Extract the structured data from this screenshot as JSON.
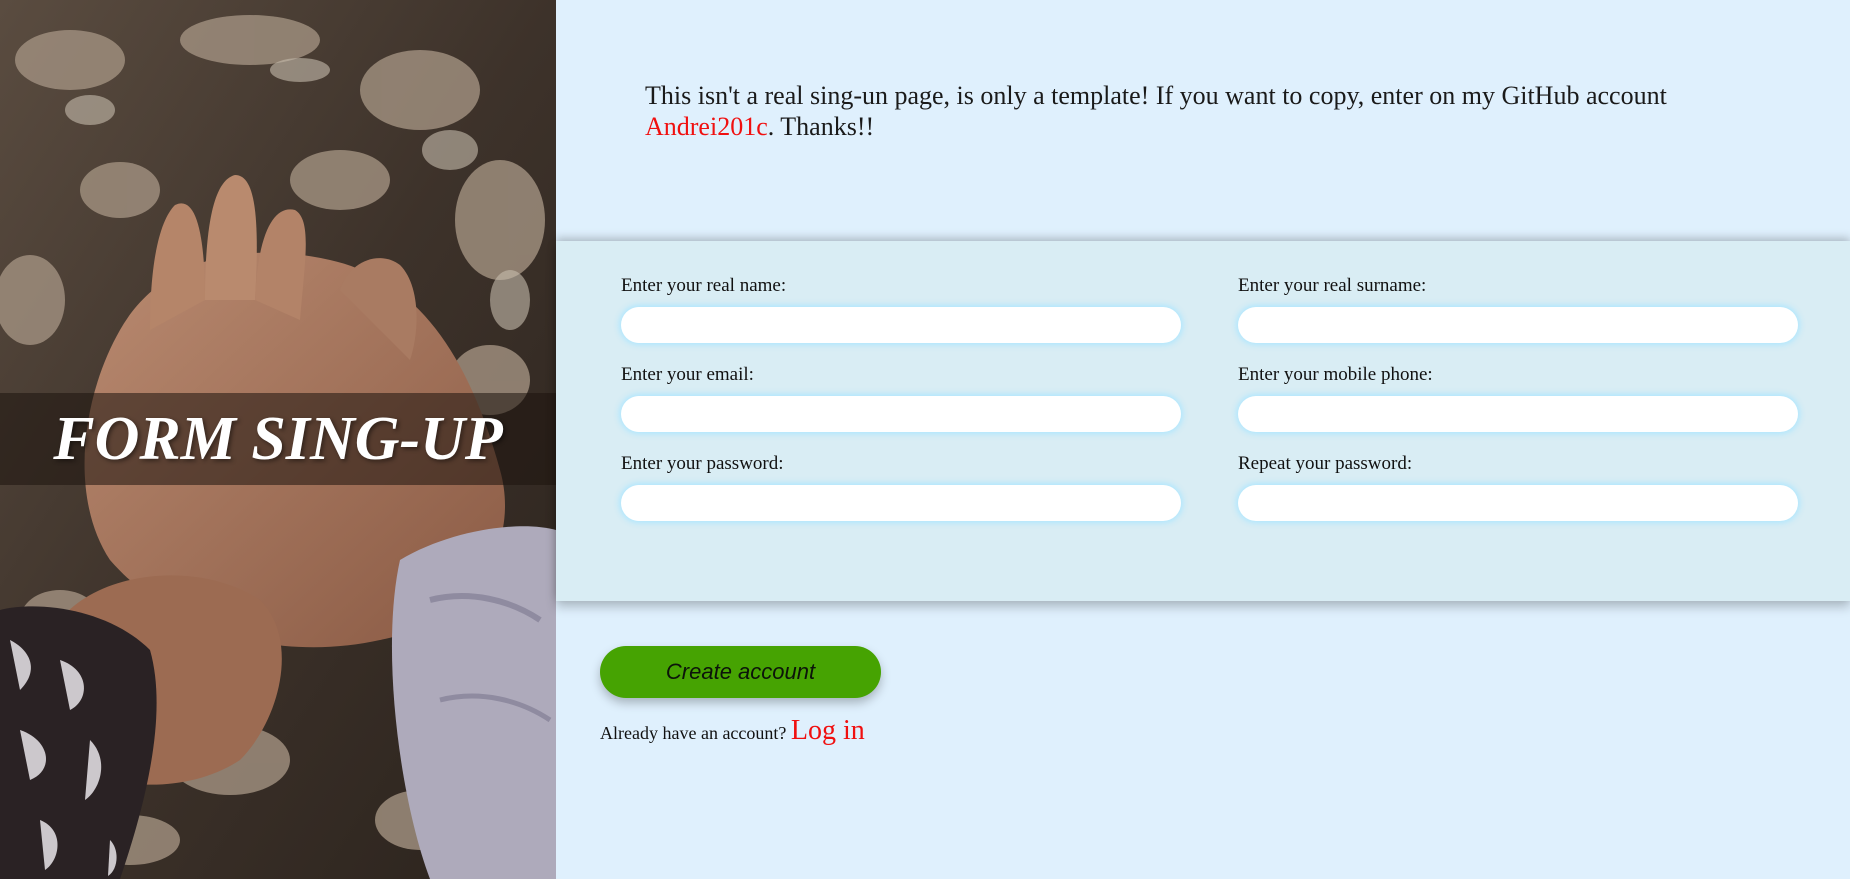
{
  "hero": {
    "title": "FORM SING-UP"
  },
  "notice": {
    "text_before": "This isn't a real sing-un page, is only a template! If you want to copy, enter on my GitHub account ",
    "link_label": "Andrei201c",
    "text_after": ". Thanks!!"
  },
  "form": {
    "name_label": "Enter your real name:",
    "surname_label": "Enter your real surname:",
    "email_label": "Enter your email:",
    "phone_label": "Enter your mobile phone:",
    "password_label": "Enter your password:",
    "repeat_password_label": "Repeat your password:",
    "name_value": "",
    "surname_value": "",
    "email_value": "",
    "phone_value": "",
    "password_value": "",
    "repeat_password_value": ""
  },
  "actions": {
    "create_label": "Create account",
    "login_prompt": "Already have an account? ",
    "login_label": "Log in"
  },
  "colors": {
    "page_background": "#dff0fd",
    "form_band": "#d9edf4",
    "link": "#f01010",
    "button": "#46a302"
  }
}
